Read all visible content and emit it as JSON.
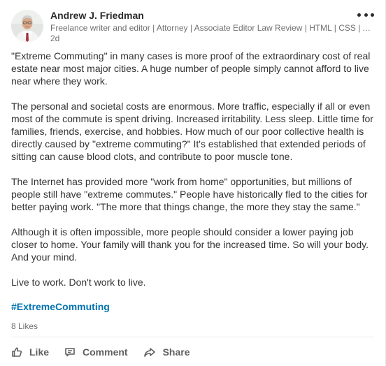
{
  "post": {
    "author": {
      "name": "Andrew J. Friedman",
      "headline": "Freelance writer and editor | Attorney | Associate Editor Law Review | HTML | CSS | A…",
      "time": "2d",
      "avatar_icon": "profile-photo"
    },
    "more_icon": "ellipsis-icon",
    "paragraphs": [
      "\"Extreme Commuting\" in many cases is more proof of the extraordinary cost of real estate near most major cities. A huge number of people simply cannot afford to live near where they work.",
      "The personal and societal costs are enormous. More traffic, especially if all or even most of the commute is spent driving. Increased irritability. Less sleep. Little time for families, friends, exercise, and hobbies. How much of our poor collective health is directly caused by \"extreme commuting?\" It's established that extended periods of sitting can cause blood clots, and contribute to poor muscle tone.",
      "The Internet has provided more \"work from home\" opportunities, but millions of people still have \"extreme commutes.\" People have historically fled to the cities for better paying work. \"The more that things change, the more they stay the same.\"",
      "Although it is often impossible, more people should consider a lower paying job closer to home. Your family will thank you for the increased time. So will your body. And your mind.",
      "Live to work. Don't work to live."
    ],
    "hashtag": "#ExtremeCommuting",
    "likes": "8 Likes"
  },
  "actions": {
    "like_label": "Like",
    "comment_label": "Comment",
    "share_label": "Share",
    "like_icon": "thumbs-up-icon",
    "comment_icon": "comment-icon",
    "share_icon": "share-icon"
  },
  "colors": {
    "hashtag": "#0073b1",
    "text": "#333333",
    "secondary": "#6f6f6f"
  }
}
